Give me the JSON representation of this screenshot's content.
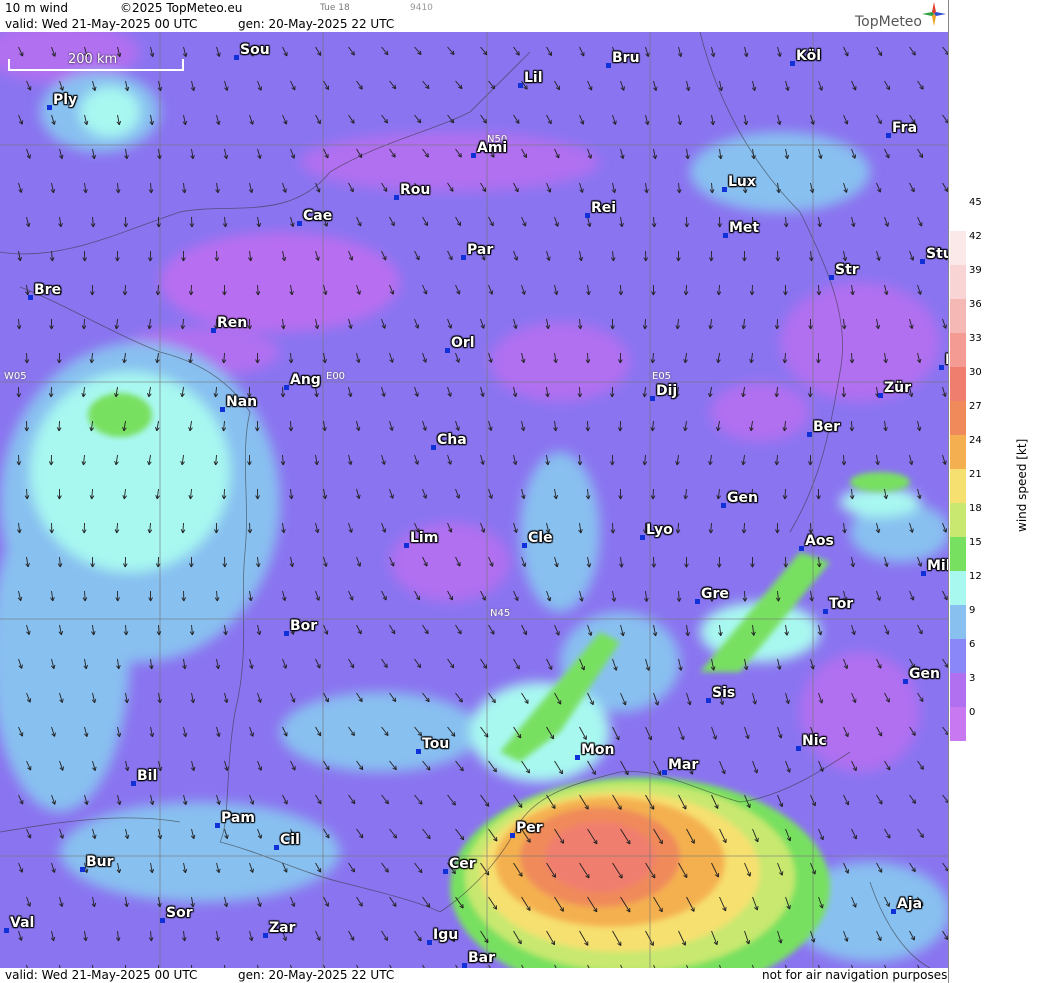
{
  "header": {
    "product": "10 m wind",
    "copyright": "©2025 TopMeteo.eu",
    "valid": "valid:  Wed  21-May-2025  00 UTC",
    "gen": "gen: 20-May-2025 22 UTC",
    "run_small": "Tue 18",
    "code_small": "9410",
    "brand": "TopMeteo"
  },
  "footer": {
    "valid": "valid:  Wed  21-May-2025  00 UTC",
    "gen": "gen: 20-May-2025 22 UTC",
    "disclaimer": "not for air navigation purposes"
  },
  "map": {
    "scale_label": "200 km",
    "grid_labels": [
      "N50",
      "W05",
      "E00",
      "E05",
      "N45"
    ],
    "cities": [
      "Sou",
      "Bru",
      "Köl",
      "Ply",
      "Lil",
      "Ami",
      "Fra",
      "Lux",
      "Rou",
      "Cae",
      "Rei",
      "Met",
      "Par",
      "Stu",
      "Str",
      "Bre",
      "Ren",
      "Orl",
      "F",
      "Ang",
      "Nan",
      "Dij",
      "Zür",
      "Ber",
      "Cha",
      "Gen",
      "Lim",
      "Cle",
      "Lyo",
      "Aos",
      "Mil",
      "Gre",
      "Tor",
      "Bor",
      "Gen",
      "Sis",
      "Nic",
      "Tou",
      "Mon",
      "Mar",
      "Bil",
      "Pam",
      "Cil",
      "Per",
      "Bur",
      "Cer",
      "Sor",
      "Aja",
      "Val",
      "Zar",
      "Igu",
      "Bar"
    ]
  },
  "legend": {
    "title": "wind speed [kt]",
    "ticks": [
      "45",
      "42",
      "39",
      "36",
      "33",
      "30",
      "27",
      "24",
      "21",
      "18",
      "15",
      "12",
      "9",
      "6",
      "3",
      "0"
    ],
    "colors": [
      "#ffffff",
      "#fbe9ea",
      "#f8d4d4",
      "#f6b8b4",
      "#f49c94",
      "#f07e6e",
      "#f08a5a",
      "#f4b050",
      "#f6e070",
      "#c8e870",
      "#78e060",
      "#a8f8f0",
      "#88c0f0",
      "#8a88f8",
      "#b070f0",
      "#c878f0"
    ]
  }
}
